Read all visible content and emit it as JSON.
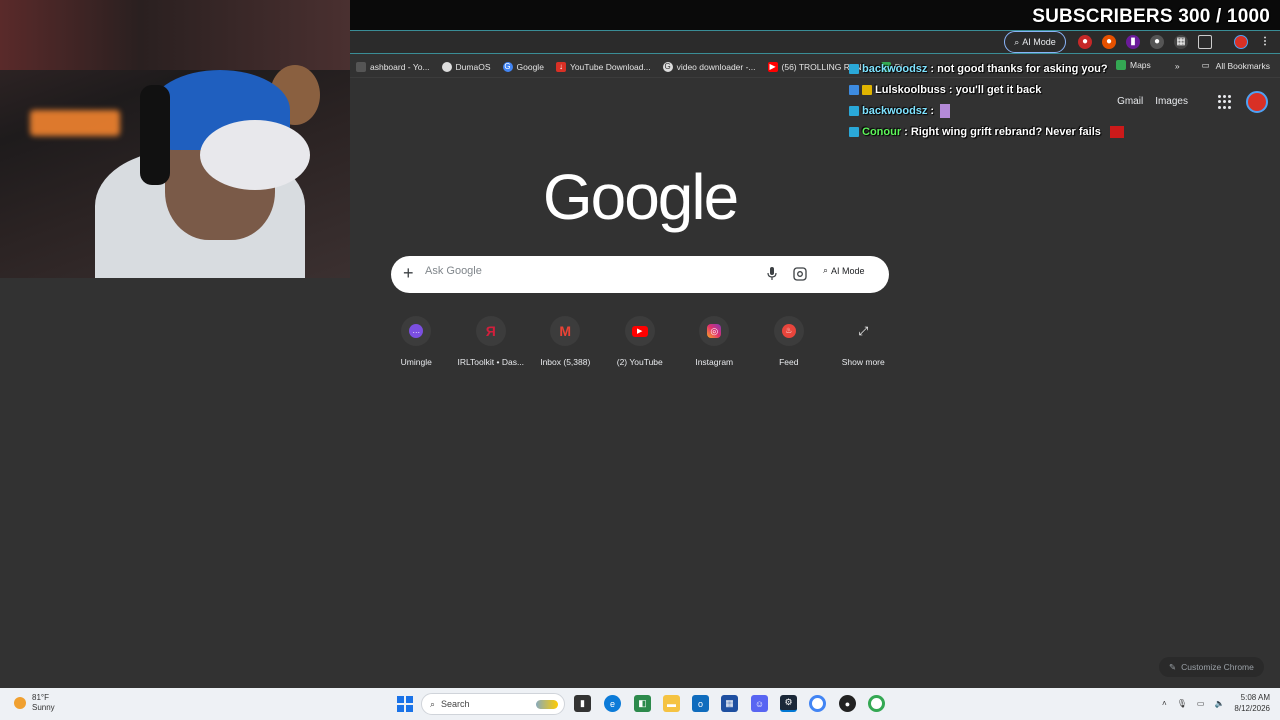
{
  "overlay": {
    "subscribers_text": "SUBSCRIBERS 300 / 1000"
  },
  "browser": {
    "omnibox_ai_mode": "AI Mode",
    "bookmarks": [
      {
        "label": "ashboard - Yo...",
        "icon": "dashboard-icon",
        "color": "#555555"
      },
      {
        "label": "DumaOS",
        "icon": "dumaos-icon",
        "color": "#dddddd"
      },
      {
        "label": "Google",
        "icon": "google-icon",
        "color": "#4285f4"
      },
      {
        "label": "YouTube Download...",
        "icon": "download-icon",
        "color": "#d93025"
      },
      {
        "label": "video downloader -...",
        "icon": "google-icon",
        "color": "#dddddd"
      },
      {
        "label": "(56) TROLLING RAN...",
        "icon": "youtube-icon",
        "color": "#ff0000"
      },
      {
        "label": "Di",
        "icon": "diamond-icon",
        "color": "#34a853"
      },
      {
        "label": "Maps",
        "icon": "maps-icon",
        "color": "#34a853"
      }
    ],
    "all_bookmarks": "All Bookmarks"
  },
  "chat": [
    {
      "user": "backwoodsz",
      "user_color": "#7fe3ff",
      "message": ": not good thanks for asking you?"
    },
    {
      "user": "Lulskoolbuss",
      "user_color": "#ffffff",
      "message": ": you'll get it back"
    },
    {
      "user": "backwoodsz",
      "user_color": "#7fe3ff",
      "message": ":"
    },
    {
      "user": "Conour",
      "user_color": "#5ef55a",
      "message": ": Right wing grift rebrand? Never fails"
    }
  ],
  "google": {
    "links": {
      "gmail": "Gmail",
      "images": "Images"
    },
    "logo": "Google",
    "search_placeholder": "Ask Google",
    "ai_mode": "AI Mode",
    "shortcuts": [
      {
        "label": "Umingle",
        "icon": "umingle-icon",
        "color": "#7b4fe0",
        "glyph": "💬"
      },
      {
        "label": "IRLToolkit • Das...",
        "icon": "irltoolkit-icon",
        "color": "#d21f3c",
        "glyph": "Я"
      },
      {
        "label": "Inbox (5,388)",
        "icon": "gmail-icon",
        "color": "#ea4335",
        "glyph": "M"
      },
      {
        "label": "(2) YouTube",
        "icon": "youtube-icon",
        "color": "#ff0000",
        "glyph": "▶"
      },
      {
        "label": "Instagram",
        "icon": "instagram-icon",
        "color": "#e1306c",
        "glyph": "◎"
      },
      {
        "label": "Feed",
        "icon": "feed-icon",
        "color": "#e8453c",
        "glyph": "♨"
      },
      {
        "label": "Show more",
        "icon": "expand-icon",
        "color": "#3c3c3c",
        "glyph": "⤢"
      }
    ],
    "customize": "Customize Chrome"
  },
  "taskbar": {
    "weather_temp": "81°F",
    "weather_desc": "Sunny",
    "search_label": "Search",
    "time": "5:08 AM",
    "date": "8/12/2026"
  }
}
